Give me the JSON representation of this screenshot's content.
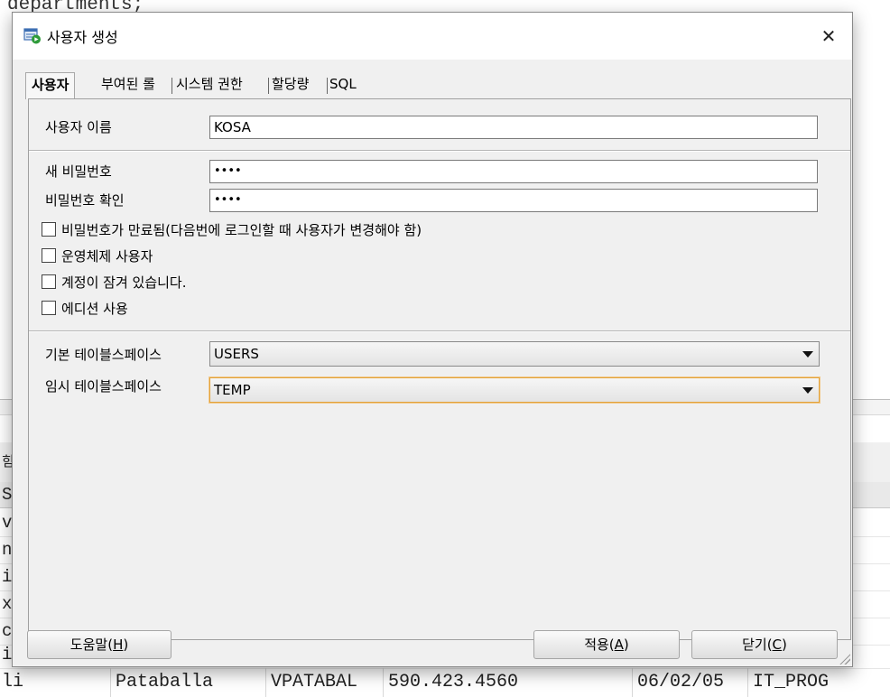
{
  "background": {
    "code_top": "departments;",
    "left_fragments": [
      "힘",
      "S",
      "v",
      "n",
      "i",
      "x",
      "c",
      "i"
    ],
    "bottom_row": {
      "c1": "li",
      "c2": "Pataballa",
      "c3": "VPATABAL",
      "c4": "590.423.4560",
      "c5": "06/02/05",
      "c6": "IT_PROG"
    }
  },
  "dialog": {
    "title": "사용자 생성",
    "close_glyph": "✕",
    "tabs": [
      "사용자",
      "부여된 롤",
      "시스템 권한",
      "할당량",
      "SQL"
    ],
    "user_name_label": "사용자 이름",
    "user_name_value": "KOSA",
    "new_password_label": "새 비밀번호",
    "new_password_value": "••••",
    "confirm_password_label": "비밀번호 확인",
    "confirm_password_value": "••••",
    "checkboxes": [
      "비밀번호가 만료됨(다음번에 로그인할 때 사용자가 변경해야 함)",
      "운영체제 사용자",
      "계정이 잠겨 있습니다.",
      "에디션 사용"
    ],
    "default_tablespace_label": "기본 테이블스페이스",
    "default_tablespace_value": "USERS",
    "temp_tablespace_label": "임시 테이블스페이스",
    "temp_tablespace_value": "TEMP",
    "help_button": {
      "prefix": "도움말(",
      "key": "H",
      "suffix": ")"
    },
    "apply_button": {
      "prefix": "적용(",
      "key": "A",
      "suffix": ")"
    },
    "close_button": {
      "prefix": "닫기(",
      "key": "C",
      "suffix": ")"
    }
  }
}
